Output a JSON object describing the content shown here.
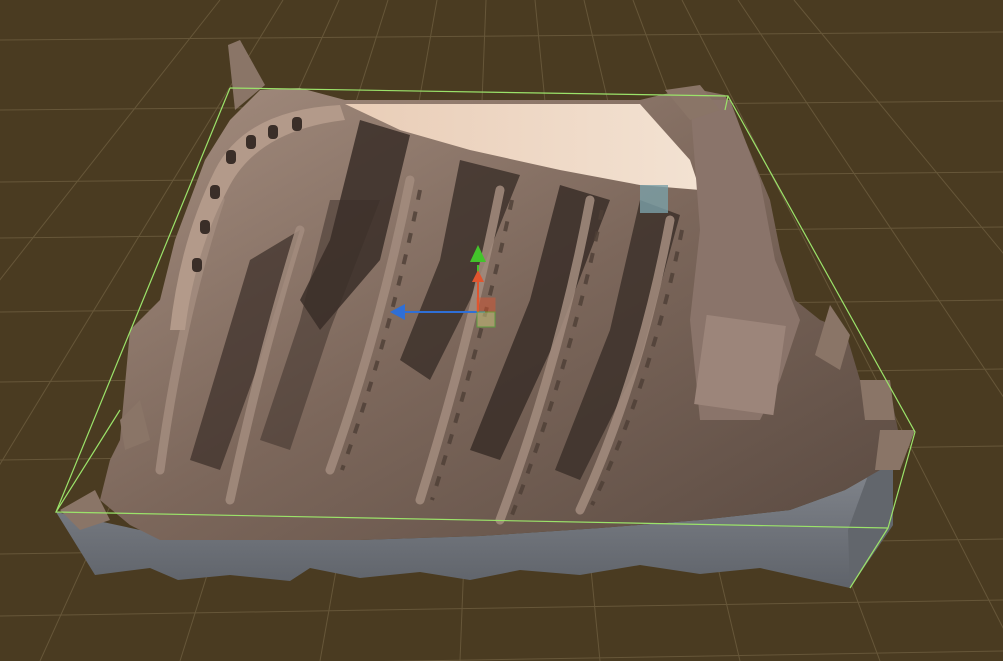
{
  "scene": {
    "colors": {
      "background": "#4a3b21",
      "grid_line": "#6a5a3c",
      "bounds_outline": "#9be36a",
      "mesh_side": "#7b7f86",
      "mesh_side_dark": "#62666c",
      "stone_light": "#9a8375",
      "stone_mid": "#7c675b",
      "stone_dark": "#3f322b",
      "arena_sand": "#efd5c1",
      "gizmo_x": "#2f6fd6",
      "gizmo_y": "#43c42b",
      "gizmo_z": "#e0552f",
      "gizmo_plane": "#c9c37b"
    },
    "gizmo": {
      "type": "move-tool",
      "axes": [
        "x",
        "y",
        "z"
      ]
    },
    "object": {
      "icon": "colosseum-mesh-icon"
    }
  }
}
